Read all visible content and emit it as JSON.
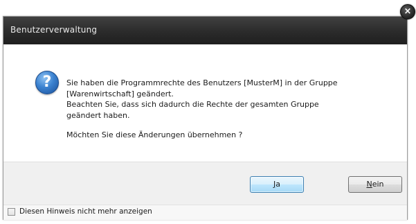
{
  "window": {
    "title": "Benutzerverwaltung",
    "close_glyph": "×"
  },
  "message": {
    "icon": "question-icon",
    "icon_glyph": "?",
    "line1": "Sie haben die Programmrechte des Benutzers [MusterM] in der Gruppe",
    "line2": "[Warenwirtschaft] geändert.",
    "line3": "Beachten Sie, dass sich dadurch die Rechte der gesamten Gruppe",
    "line4": "geändert haben.",
    "question": "Möchten Sie diese Änderungen übernehmen ?"
  },
  "buttons": {
    "yes": {
      "mnemonic": "J",
      "rest": "a"
    },
    "no": {
      "mnemonic": "N",
      "rest": "ein"
    }
  },
  "footer": {
    "checkbox_label": "Diesen Hinweis nicht mehr anzeigen",
    "checked": false
  },
  "colors": {
    "titlebar": "#2b2b2b",
    "default_button_border": "#3c7fb1",
    "question_icon": "#3b82d0"
  }
}
